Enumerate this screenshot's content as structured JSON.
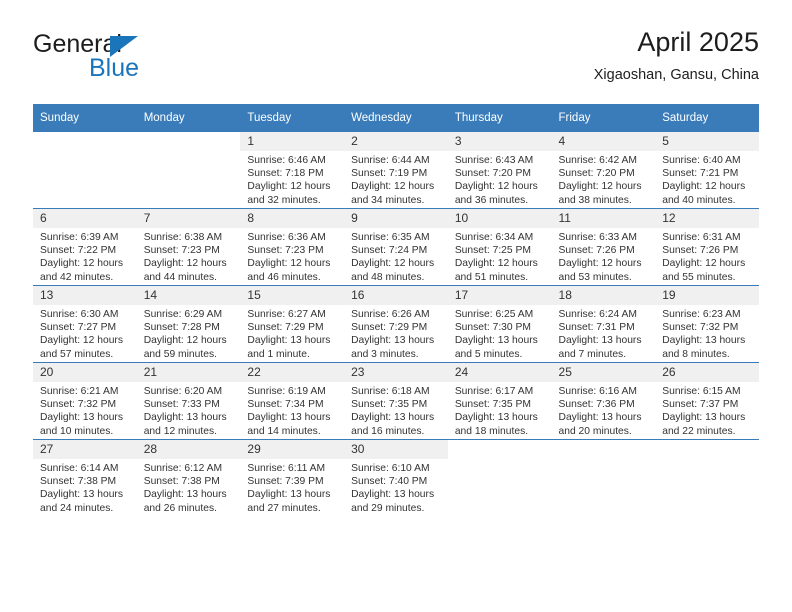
{
  "brand": {
    "word_one": "General",
    "word_two": "Blue",
    "triangle_color": "#1b75bb"
  },
  "header": {
    "title": "April 2025",
    "subtitle": "Xigaoshan, Gansu, China",
    "accent_color": "#3a7cba",
    "daynum_bg": "#f0f0f0"
  },
  "weekday_headers": [
    "Sunday",
    "Monday",
    "Tuesday",
    "Wednesday",
    "Thursday",
    "Friday",
    "Saturday"
  ],
  "weeks": [
    [
      {
        "day": "",
        "sunrise": "",
        "sunset": "",
        "daylight_line1": "",
        "daylight_line2": ""
      },
      {
        "day": "",
        "sunrise": "",
        "sunset": "",
        "daylight_line1": "",
        "daylight_line2": ""
      },
      {
        "day": "1",
        "sunrise": "Sunrise: 6:46 AM",
        "sunset": "Sunset: 7:18 PM",
        "daylight_line1": "Daylight: 12 hours",
        "daylight_line2": "and 32 minutes."
      },
      {
        "day": "2",
        "sunrise": "Sunrise: 6:44 AM",
        "sunset": "Sunset: 7:19 PM",
        "daylight_line1": "Daylight: 12 hours",
        "daylight_line2": "and 34 minutes."
      },
      {
        "day": "3",
        "sunrise": "Sunrise: 6:43 AM",
        "sunset": "Sunset: 7:20 PM",
        "daylight_line1": "Daylight: 12 hours",
        "daylight_line2": "and 36 minutes."
      },
      {
        "day": "4",
        "sunrise": "Sunrise: 6:42 AM",
        "sunset": "Sunset: 7:20 PM",
        "daylight_line1": "Daylight: 12 hours",
        "daylight_line2": "and 38 minutes."
      },
      {
        "day": "5",
        "sunrise": "Sunrise: 6:40 AM",
        "sunset": "Sunset: 7:21 PM",
        "daylight_line1": "Daylight: 12 hours",
        "daylight_line2": "and 40 minutes."
      }
    ],
    [
      {
        "day": "6",
        "sunrise": "Sunrise: 6:39 AM",
        "sunset": "Sunset: 7:22 PM",
        "daylight_line1": "Daylight: 12 hours",
        "daylight_line2": "and 42 minutes."
      },
      {
        "day": "7",
        "sunrise": "Sunrise: 6:38 AM",
        "sunset": "Sunset: 7:23 PM",
        "daylight_line1": "Daylight: 12 hours",
        "daylight_line2": "and 44 minutes."
      },
      {
        "day": "8",
        "sunrise": "Sunrise: 6:36 AM",
        "sunset": "Sunset: 7:23 PM",
        "daylight_line1": "Daylight: 12 hours",
        "daylight_line2": "and 46 minutes."
      },
      {
        "day": "9",
        "sunrise": "Sunrise: 6:35 AM",
        "sunset": "Sunset: 7:24 PM",
        "daylight_line1": "Daylight: 12 hours",
        "daylight_line2": "and 48 minutes."
      },
      {
        "day": "10",
        "sunrise": "Sunrise: 6:34 AM",
        "sunset": "Sunset: 7:25 PM",
        "daylight_line1": "Daylight: 12 hours",
        "daylight_line2": "and 51 minutes."
      },
      {
        "day": "11",
        "sunrise": "Sunrise: 6:33 AM",
        "sunset": "Sunset: 7:26 PM",
        "daylight_line1": "Daylight: 12 hours",
        "daylight_line2": "and 53 minutes."
      },
      {
        "day": "12",
        "sunrise": "Sunrise: 6:31 AM",
        "sunset": "Sunset: 7:26 PM",
        "daylight_line1": "Daylight: 12 hours",
        "daylight_line2": "and 55 minutes."
      }
    ],
    [
      {
        "day": "13",
        "sunrise": "Sunrise: 6:30 AM",
        "sunset": "Sunset: 7:27 PM",
        "daylight_line1": "Daylight: 12 hours",
        "daylight_line2": "and 57 minutes."
      },
      {
        "day": "14",
        "sunrise": "Sunrise: 6:29 AM",
        "sunset": "Sunset: 7:28 PM",
        "daylight_line1": "Daylight: 12 hours",
        "daylight_line2": "and 59 minutes."
      },
      {
        "day": "15",
        "sunrise": "Sunrise: 6:27 AM",
        "sunset": "Sunset: 7:29 PM",
        "daylight_line1": "Daylight: 13 hours",
        "daylight_line2": "and 1 minute."
      },
      {
        "day": "16",
        "sunrise": "Sunrise: 6:26 AM",
        "sunset": "Sunset: 7:29 PM",
        "daylight_line1": "Daylight: 13 hours",
        "daylight_line2": "and 3 minutes."
      },
      {
        "day": "17",
        "sunrise": "Sunrise: 6:25 AM",
        "sunset": "Sunset: 7:30 PM",
        "daylight_line1": "Daylight: 13 hours",
        "daylight_line2": "and 5 minutes."
      },
      {
        "day": "18",
        "sunrise": "Sunrise: 6:24 AM",
        "sunset": "Sunset: 7:31 PM",
        "daylight_line1": "Daylight: 13 hours",
        "daylight_line2": "and 7 minutes."
      },
      {
        "day": "19",
        "sunrise": "Sunrise: 6:23 AM",
        "sunset": "Sunset: 7:32 PM",
        "daylight_line1": "Daylight: 13 hours",
        "daylight_line2": "and 8 minutes."
      }
    ],
    [
      {
        "day": "20",
        "sunrise": "Sunrise: 6:21 AM",
        "sunset": "Sunset: 7:32 PM",
        "daylight_line1": "Daylight: 13 hours",
        "daylight_line2": "and 10 minutes."
      },
      {
        "day": "21",
        "sunrise": "Sunrise: 6:20 AM",
        "sunset": "Sunset: 7:33 PM",
        "daylight_line1": "Daylight: 13 hours",
        "daylight_line2": "and 12 minutes."
      },
      {
        "day": "22",
        "sunrise": "Sunrise: 6:19 AM",
        "sunset": "Sunset: 7:34 PM",
        "daylight_line1": "Daylight: 13 hours",
        "daylight_line2": "and 14 minutes."
      },
      {
        "day": "23",
        "sunrise": "Sunrise: 6:18 AM",
        "sunset": "Sunset: 7:35 PM",
        "daylight_line1": "Daylight: 13 hours",
        "daylight_line2": "and 16 minutes."
      },
      {
        "day": "24",
        "sunrise": "Sunrise: 6:17 AM",
        "sunset": "Sunset: 7:35 PM",
        "daylight_line1": "Daylight: 13 hours",
        "daylight_line2": "and 18 minutes."
      },
      {
        "day": "25",
        "sunrise": "Sunrise: 6:16 AM",
        "sunset": "Sunset: 7:36 PM",
        "daylight_line1": "Daylight: 13 hours",
        "daylight_line2": "and 20 minutes."
      },
      {
        "day": "26",
        "sunrise": "Sunrise: 6:15 AM",
        "sunset": "Sunset: 7:37 PM",
        "daylight_line1": "Daylight: 13 hours",
        "daylight_line2": "and 22 minutes."
      }
    ],
    [
      {
        "day": "27",
        "sunrise": "Sunrise: 6:14 AM",
        "sunset": "Sunset: 7:38 PM",
        "daylight_line1": "Daylight: 13 hours",
        "daylight_line2": "and 24 minutes."
      },
      {
        "day": "28",
        "sunrise": "Sunrise: 6:12 AM",
        "sunset": "Sunset: 7:38 PM",
        "daylight_line1": "Daylight: 13 hours",
        "daylight_line2": "and 26 minutes."
      },
      {
        "day": "29",
        "sunrise": "Sunrise: 6:11 AM",
        "sunset": "Sunset: 7:39 PM",
        "daylight_line1": "Daylight: 13 hours",
        "daylight_line2": "and 27 minutes."
      },
      {
        "day": "30",
        "sunrise": "Sunrise: 6:10 AM",
        "sunset": "Sunset: 7:40 PM",
        "daylight_line1": "Daylight: 13 hours",
        "daylight_line2": "and 29 minutes."
      },
      {
        "day": "",
        "sunrise": "",
        "sunset": "",
        "daylight_line1": "",
        "daylight_line2": ""
      },
      {
        "day": "",
        "sunrise": "",
        "sunset": "",
        "daylight_line1": "",
        "daylight_line2": ""
      },
      {
        "day": "",
        "sunrise": "",
        "sunset": "",
        "daylight_line1": "",
        "daylight_line2": ""
      }
    ]
  ]
}
